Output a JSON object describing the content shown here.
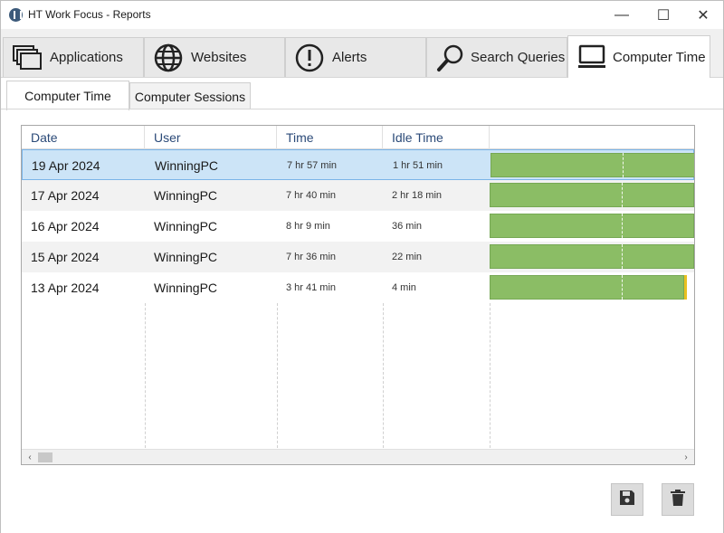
{
  "window": {
    "title": "HT Work Focus - Reports",
    "minimize": "—",
    "maximize": "☐",
    "close": "✕"
  },
  "main_tabs": [
    {
      "label": "Applications",
      "icon": "applications-icon"
    },
    {
      "label": "Websites",
      "icon": "globe-icon"
    },
    {
      "label": "Alerts",
      "icon": "alert-icon"
    },
    {
      "label": "Search Queries",
      "icon": "search-icon"
    },
    {
      "label": "Computer Time",
      "icon": "laptop-icon",
      "active": true
    }
  ],
  "sub_tabs": [
    {
      "label": "Computer Time",
      "active": true
    },
    {
      "label": "Computer Sessions"
    }
  ],
  "table": {
    "columns": [
      "Date",
      "User",
      "Time",
      "Idle Time"
    ],
    "rows": [
      {
        "date": "19 Apr 2024",
        "user": "WinningPC",
        "time": "7 hr 57 min",
        "idle": "1 hr 51 min",
        "bar_fill": 1.0,
        "bar_end_marker": false
      },
      {
        "date": "17 Apr 2024",
        "user": "WinningPC",
        "time": "7 hr 40 min",
        "idle": "2 hr 18 min",
        "bar_fill": 1.0,
        "bar_end_marker": false
      },
      {
        "date": "16 Apr 2024",
        "user": "WinningPC",
        "time": "8 hr 9 min",
        "idle": "36 min",
        "bar_fill": 1.0,
        "bar_end_marker": false
      },
      {
        "date": "15 Apr 2024",
        "user": "WinningPC",
        "time": "7 hr 36 min",
        "idle": "22 min",
        "bar_fill": 1.0,
        "bar_end_marker": false
      },
      {
        "date": "13 Apr 2024",
        "user": "WinningPC",
        "time": "3 hr 41 min",
        "idle": "4 min",
        "bar_fill": 0.95,
        "bar_end_marker": true
      }
    ]
  },
  "scrollbar": {
    "left_arrow": "‹",
    "right_arrow": "›"
  },
  "actions": {
    "save_icon": "save-icon",
    "delete_icon": "trash-icon"
  },
  "colors": {
    "bar_green": "#8bbd65",
    "bar_marker": "#e8c020",
    "selected_row": "#cce4f7",
    "header_text": "#2b4a78"
  }
}
